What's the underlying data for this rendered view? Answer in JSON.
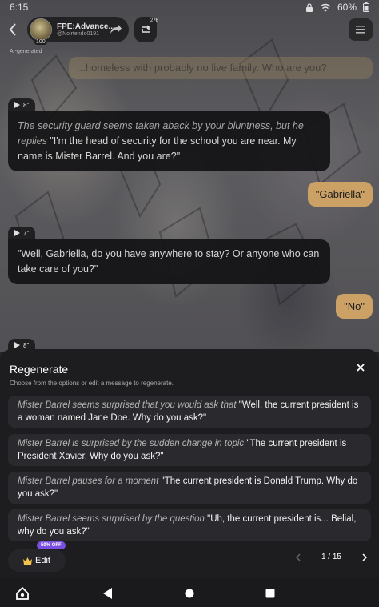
{
  "status_bar": {
    "time": "6:15",
    "battery": "60%"
  },
  "header": {
    "bot_name": "FPE:Advance...",
    "bot_handle": "@Noirtendo0191",
    "avatar_badge": "100",
    "memory_count": "276"
  },
  "chat": {
    "ai_generated_label": "AI-generated",
    "user_msg_top": "...homeless with probably no live family. Who are you?",
    "messages": [
      {
        "duration": "8\"",
        "action": "The security guard seems taken aback by your bluntness, but he replies",
        "text": "\"I'm the head of security for the school you are near. My name is Mister Barrel. And you are?\""
      },
      {
        "user": "\"Gabriella\""
      },
      {
        "duration": "7\"",
        "text": "\"Well, Gabriella, do you have anywhere to stay? Or anyone who can take care of you?\""
      },
      {
        "user": "\"No\""
      },
      {
        "duration": "8\""
      }
    ]
  },
  "regenerate": {
    "title": "Regenerate",
    "subtitle": "Choose from the options or edit a message to regenerate.",
    "options": [
      {
        "action": "Mister Barrel seems surprised that you would ask that",
        "text": " \"Well, the current president is a woman named Jane Doe. Why do you ask?\""
      },
      {
        "action": "Mister Barrel is surprised by the sudden change in topic",
        "text": " \"The current president is President Xavier. Why do you ask?\""
      },
      {
        "action": "Mister Barrel pauses for a moment",
        "text": " \"The current president is Donald Trump. Why do you ask?\""
      },
      {
        "action": "Mister Barrel seems surprised by the question",
        "text": " \"Uh, the current president is... Belial, why do you ask?\""
      }
    ],
    "edit_label": "Edit",
    "discount_label": "59% OFF",
    "page": "1 / 15"
  }
}
